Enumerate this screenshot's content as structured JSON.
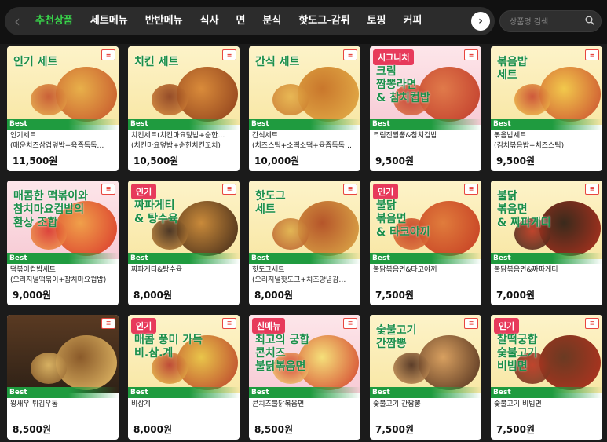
{
  "nav": {
    "tabs": [
      {
        "label": "추천상품",
        "active": true
      },
      {
        "label": "세트메뉴",
        "active": false
      },
      {
        "label": "반반메뉴",
        "active": false
      },
      {
        "label": "식사",
        "active": false
      },
      {
        "label": "면",
        "active": false
      },
      {
        "label": "분식",
        "active": false
      },
      {
        "label": "핫도그-감튀",
        "active": false
      },
      {
        "label": "토핑",
        "active": false
      },
      {
        "label": "커피",
        "active": false
      }
    ],
    "prev_icon": "chevron-left-icon",
    "next_icon": "chevron-right-icon"
  },
  "search": {
    "placeholder": "상품명 검색",
    "value": "",
    "icon": "search-icon"
  },
  "colors": {
    "accent": "#38d24a",
    "best_tag": "#1f9b3f",
    "badge_pink": "#e73a5b"
  },
  "products": [
    {
      "thumb_text": "인기 세트",
      "ribbon": "",
      "tag": "Best",
      "name": "인기세트",
      "desc": "(매운치즈삼겹덮밥+육즙독독…",
      "price": "11,500원",
      "style": "yellow"
    },
    {
      "thumb_text": "치킨 세트",
      "ribbon": "",
      "tag": "Best",
      "name": "치킨세트(치킨마요덮밥+순한…",
      "desc": "(치킨마요덮밥+순한치킨꼬치)",
      "price": "10,500원",
      "style": "yellow"
    },
    {
      "thumb_text": "간식 세트",
      "ribbon": "",
      "tag": "Best",
      "name": "간식세트",
      "desc": "(치즈스틱+소떡소떡+육즙독독…",
      "price": "10,000원",
      "style": "yellow"
    },
    {
      "thumb_text": "크림\n짬뽕라면\n& 참치컵밥",
      "ribbon": "시그니처",
      "tag": "Best",
      "name": "크림진짬뽕&참치컵밥",
      "desc": "",
      "price": "9,500원",
      "style": "pink"
    },
    {
      "thumb_text": "볶음밥\n세트",
      "ribbon": "",
      "tag": "Best",
      "name": "볶음밥세트",
      "desc": "(김치볶음밥+치즈스틱)",
      "price": "9,500원",
      "style": "yellow"
    },
    {
      "thumb_text": "매콤한 떡볶이와\n참치마요컵밥의\n환상 조합",
      "ribbon": "",
      "tag": "Best",
      "name": "떡볶이컵밥세트",
      "desc": "(오리지널떡볶이+참치마요컵밥)",
      "price": "9,000원",
      "style": "pink"
    },
    {
      "thumb_text": "짜파게티\n& 탕수육",
      "ribbon": "인기",
      "tag": "Best",
      "name": "짜파게티&탕수육",
      "desc": "",
      "price": "8,000원",
      "style": "yellow"
    },
    {
      "thumb_text": "핫도그\n세트",
      "ribbon": "",
      "tag": "Best",
      "name": "핫도그세트",
      "desc": "(오리지널핫도그+치즈양념감…",
      "price": "8,000원",
      "style": "yellow"
    },
    {
      "thumb_text": "불닭\n볶음면\n& 타코야끼",
      "ribbon": "인기",
      "tag": "Best",
      "name": "불닭볶음면&타코야끼",
      "desc": "",
      "price": "7,500원",
      "style": "yellow"
    },
    {
      "thumb_text": "불닭\n볶음면\n& 짜파게티",
      "ribbon": "",
      "tag": "Best",
      "name": "불닭볶음면&짜파게티",
      "desc": "",
      "price": "7,000원",
      "style": "yellow"
    },
    {
      "thumb_text": "",
      "ribbon": "",
      "tag": "Best",
      "name": "왕새우 튀김우동",
      "desc": "",
      "price": "8,500원",
      "style": "photo"
    },
    {
      "thumb_text": "매콤 풍미 가득\n비.삼.계",
      "ribbon": "인기",
      "tag": "Best",
      "name": "비삼계",
      "desc": "",
      "price": "8,000원",
      "style": "yellow"
    },
    {
      "thumb_text": "최고의 궁합\n콘치즈\n불닭볶음면",
      "ribbon": "신메뉴",
      "tag": "Best",
      "name": "콘치즈불닭볶음면",
      "desc": "",
      "price": "8,500원",
      "style": "pink"
    },
    {
      "thumb_text": "숯불고기\n간짬뽕",
      "ribbon": "",
      "tag": "Best",
      "name": "숯불고기 간짬뽕",
      "desc": "",
      "price": "7,500원",
      "style": "yellow"
    },
    {
      "thumb_text": "찰떡궁합\n숯불고기\n비빔면",
      "ribbon": "인기",
      "tag": "Best",
      "name": "숯불고기 비빔면",
      "desc": "",
      "price": "7,500원",
      "style": "yellow"
    }
  ]
}
